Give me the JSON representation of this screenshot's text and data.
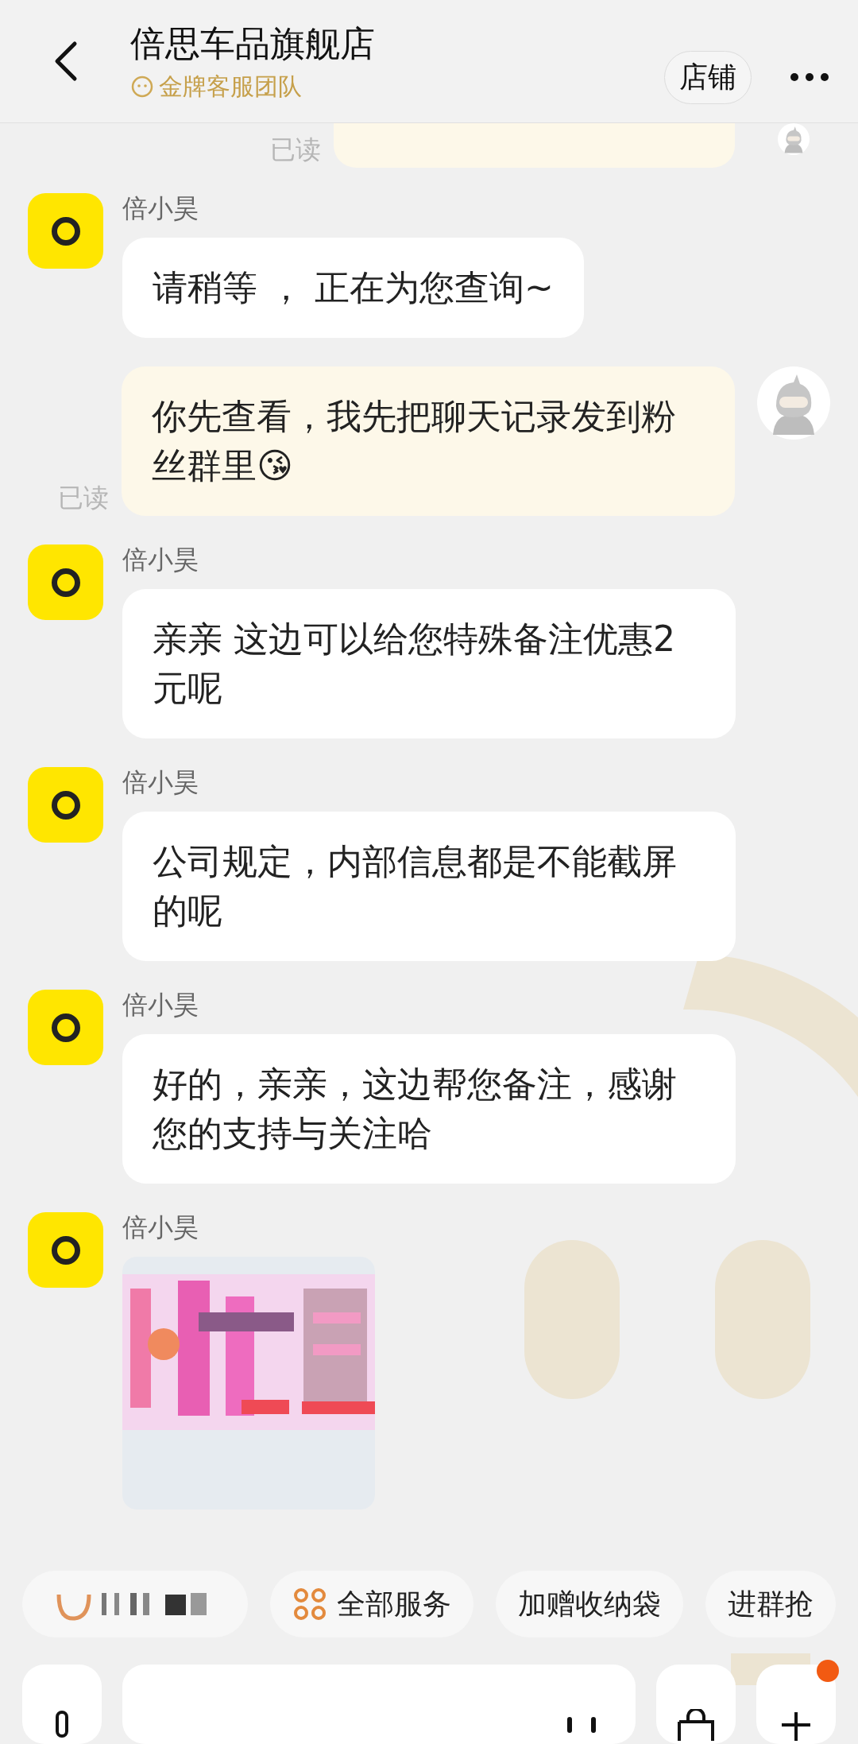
{
  "header": {
    "title": "倍思车品旗舰店",
    "subtitle": "金牌客服团队",
    "shop_button": "店铺"
  },
  "messages": [
    {
      "kind": "cut",
      "outgoing": true,
      "read_receipt": "已读"
    },
    {
      "kind": "text",
      "outgoing": false,
      "sender": "倍小昊",
      "text": "请稍等 ， 正在为您查询~"
    },
    {
      "kind": "text",
      "outgoing": true,
      "read_receipt": "已读",
      "text": "你先查看，我先把聊天记录发到粉丝群里😘"
    },
    {
      "kind": "text",
      "outgoing": false,
      "sender": "倍小昊",
      "text": "亲亲 这边可以给您特殊备注优惠2元呢"
    },
    {
      "kind": "text",
      "outgoing": false,
      "sender": "倍小昊",
      "text": "公司规定，内部信息都是不能截屏的呢"
    },
    {
      "kind": "text",
      "outgoing": false,
      "sender": "倍小昊",
      "text": "好的，亲亲，这边帮您备注，感谢您的支持与关注哈"
    },
    {
      "outgoing": false,
      "sender": "倍小昊"
    }
  ],
  "quick_chips": [
    {
      "kind": "blurred"
    },
    {
      "kind": "services",
      "label": "全部服务"
    },
    {
      "kind": "text",
      "label": "加赠收纳袋"
    },
    {
      "kind": "text",
      "label": "进群抢"
    }
  ],
  "input_bar": {
    "plus_badge": true
  }
}
